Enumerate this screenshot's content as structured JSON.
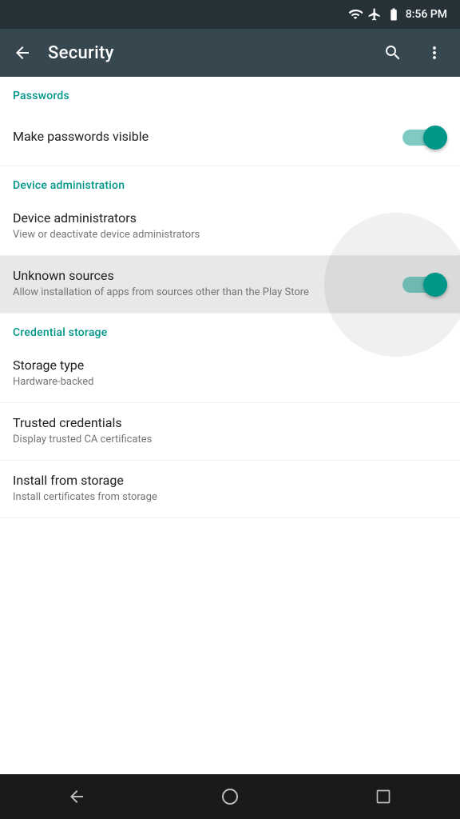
{
  "statusBar": {
    "time": "8:56 PM"
  },
  "appBar": {
    "title": "Security",
    "backLabel": "back",
    "searchLabel": "search",
    "moreLabel": "more options"
  },
  "sections": [
    {
      "id": "passwords",
      "header": "Passwords",
      "items": [
        {
          "id": "make-passwords-visible",
          "title": "Make passwords visible",
          "subtitle": "",
          "hasToggle": true,
          "toggleOn": true,
          "highlighted": false
        }
      ]
    },
    {
      "id": "device-administration",
      "header": "Device administration",
      "items": [
        {
          "id": "device-administrators",
          "title": "Device administrators",
          "subtitle": "View or deactivate device administrators",
          "hasToggle": false,
          "highlighted": false
        },
        {
          "id": "unknown-sources",
          "title": "Unknown sources",
          "subtitle": "Allow installation of apps from sources other than the Play Store",
          "hasToggle": true,
          "toggleOn": true,
          "highlighted": true
        }
      ]
    },
    {
      "id": "credential-storage",
      "header": "Credential storage",
      "items": [
        {
          "id": "storage-type",
          "title": "Storage type",
          "subtitle": "Hardware-backed",
          "hasToggle": false,
          "highlighted": false
        },
        {
          "id": "trusted-credentials",
          "title": "Trusted credentials",
          "subtitle": "Display trusted CA certificates",
          "hasToggle": false,
          "highlighted": false
        },
        {
          "id": "install-from-storage",
          "title": "Install from storage",
          "subtitle": "Install certificates from storage",
          "hasToggle": false,
          "highlighted": false
        }
      ]
    }
  ],
  "navBar": {
    "backLabel": "navigate back",
    "homeLabel": "navigate home",
    "recentsLabel": "recent apps"
  }
}
